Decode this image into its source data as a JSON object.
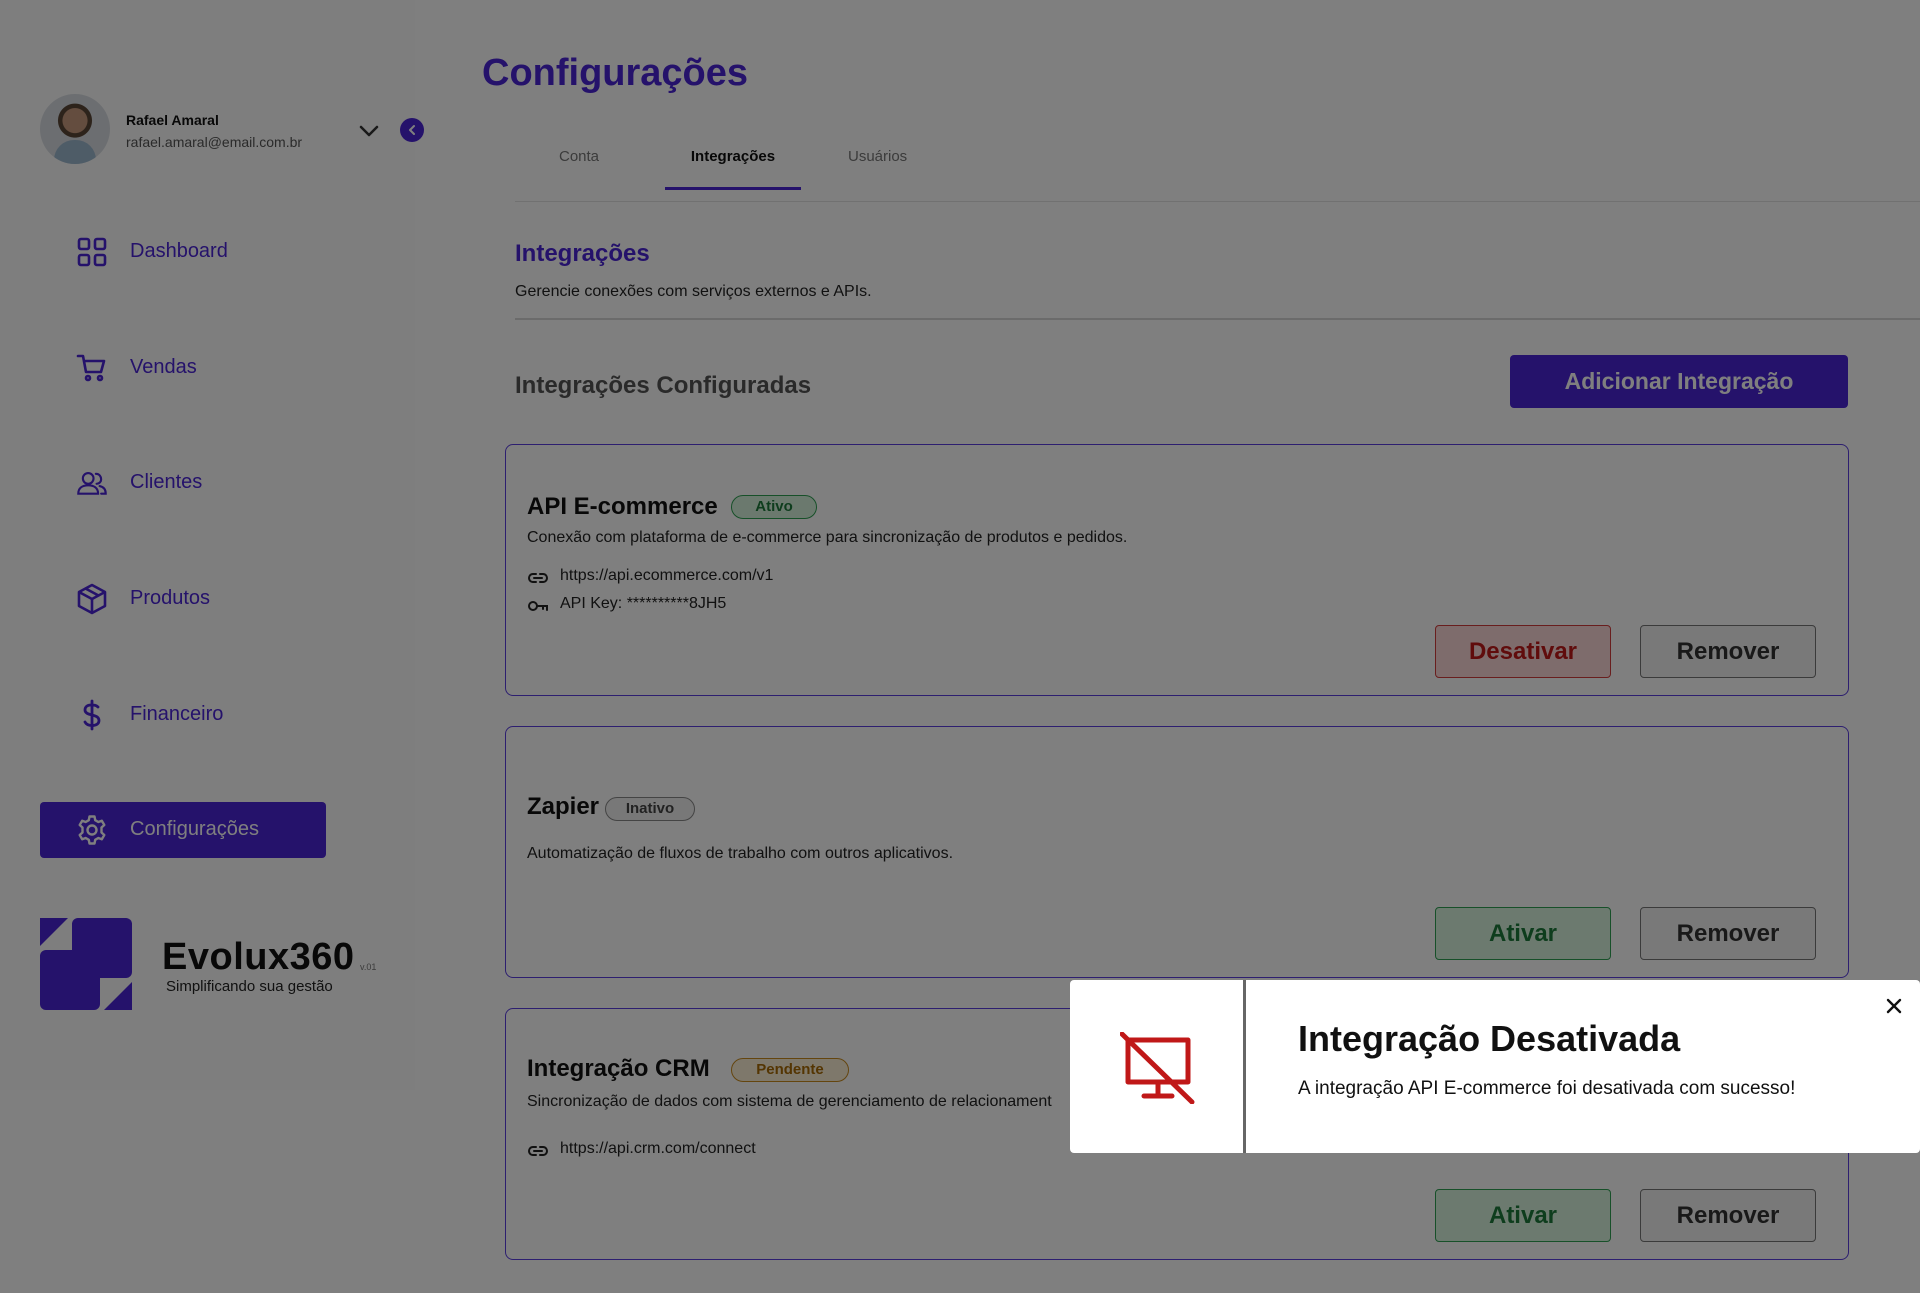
{
  "user": {
    "name": "Rafael Amaral",
    "email": "rafael.amaral@email.com.br"
  },
  "sidebar": {
    "items": [
      {
        "label": "Dashboard",
        "icon": "dashboard-grid-icon"
      },
      {
        "label": "Vendas",
        "icon": "shopping-cart-icon"
      },
      {
        "label": "Clientes",
        "icon": "users-icon"
      },
      {
        "label": "Produtos",
        "icon": "box-icon"
      },
      {
        "label": "Financeiro",
        "icon": "dollar-icon"
      },
      {
        "label": "Configurações",
        "icon": "gear-icon",
        "active": true
      }
    ]
  },
  "brand": {
    "name": "Evolux360",
    "version": "v.01",
    "tagline": "Simplificando sua gestão"
  },
  "page": {
    "title": "Configurações"
  },
  "tabs": [
    {
      "label": "Conta"
    },
    {
      "label": "Integrações",
      "active": true
    },
    {
      "label": "Usuários"
    }
  ],
  "section": {
    "title": "Integrações",
    "description": "Gerencie conexões com serviços externos e APIs.",
    "subtitle": "Integrações Configuradas",
    "add_button": "Adicionar Integração"
  },
  "integrations": [
    {
      "name": "API E-commerce",
      "status": "Ativo",
      "description": "Conexão com plataforma de e-commerce para sincronização de produtos e pedidos.",
      "url": "https://api.ecommerce.com/v1",
      "api_key": "API Key: **********8JH5",
      "primary_action": "Desativar",
      "remove_action": "Remover"
    },
    {
      "name": "Zapier",
      "status": "Inativo",
      "description": "Automatização de fluxos de trabalho com outros aplicativos.",
      "primary_action": "Ativar",
      "remove_action": "Remover"
    },
    {
      "name": "Integração CRM",
      "status": "Pendente",
      "description": "Sincronização de dados com sistema de gerenciamento de relacionament",
      "url": "https://api.crm.com/connect",
      "primary_action": "Ativar",
      "remove_action": "Remover"
    }
  ],
  "toast": {
    "title": "Integração Desativada",
    "message": "A integração API E-commerce foi desativada com sucesso!",
    "icon": "monitor-off-icon"
  },
  "colors": {
    "accent": "#4b24d6",
    "success": "#2fa052",
    "danger": "#d33c3c",
    "warning": "#c98a1d"
  }
}
